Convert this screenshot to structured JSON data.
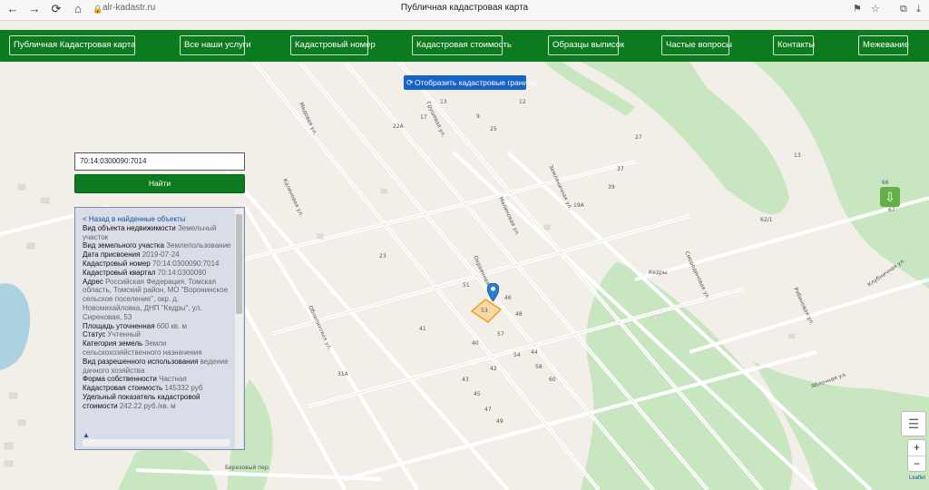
{
  "browser": {
    "url": "alr-kadastr.ru",
    "title": "Публичная кадастровая карта"
  },
  "menu": [
    "Публичная Кадастровая карта",
    "Все наши услуги",
    "Кадастровый номер",
    "Кадастровая стоимость",
    "Образцы выписок",
    "Частые вопросы",
    "Контакты",
    "Межевание"
  ],
  "map": {
    "borders_button": "Отобразить кадастровые границы",
    "search_value": "70:14:0300090:7014",
    "search_button": "Найти",
    "attribution": "Leaflet",
    "place_label": "Кедры",
    "street_labels": [
      "Медовая ул.",
      "Грушевая ул.",
      "Окраинная ул.",
      "Смородиновая ул.",
      "Рябиновая ул.",
      "Яблочная ул.",
      "Клубничная ул.",
      "Березовый пер.",
      "Калиновая ул.",
      "Земляничная ул.",
      "Малиновая ул.",
      "Облепиховая ул."
    ],
    "plot_numbers": [
      "22А",
      "17",
      "13",
      "12",
      "9",
      "51",
      "46",
      "53",
      "57",
      "48",
      "44",
      "40",
      "42",
      "31А",
      "43",
      "45",
      "47",
      "49",
      "54",
      "58",
      "60",
      "62/1",
      "13",
      "19А",
      "25",
      "27",
      "37",
      "39",
      "41",
      "66",
      "67",
      "23"
    ]
  },
  "info": {
    "back": "< Назад в найденные объекты",
    "rows": [
      {
        "label": "Вид объекта недвижимости",
        "value": "Земельный участок"
      },
      {
        "label": "Вид земельного участка",
        "value": "Землепользование"
      },
      {
        "label": "Дата присвоения",
        "value": "2019-07-24"
      },
      {
        "label": "Кадастровый номер",
        "value": "70:14:0300090:7014"
      },
      {
        "label": "Кадастровый квартал",
        "value": "70:14:0300090"
      },
      {
        "label": "Адрес",
        "value": "Российская Федерация, Томская область, Томский район, МО \"Воронинское сельское поселение\", окр. д. Новомихайловка, ДНП \"Кедры\", ул. Сиреновая, 53"
      },
      {
        "label": "Площадь уточненная",
        "value": "600 кв. м"
      },
      {
        "label": "Статус",
        "value": "Учтенный"
      },
      {
        "label": "Категория земель",
        "value": "Земли сельскохозяйственного назначения"
      },
      {
        "label": "Вид разрешенного использования",
        "value": "ведение дачного хозяйства"
      },
      {
        "label": "Форма собственности",
        "value": "Частная"
      },
      {
        "label": "Кадастровая стоимость",
        "value": "145332 руб"
      },
      {
        "label": "Удельный показатель кадастровой стоимости",
        "value": "242.22 руб./кв. м"
      }
    ]
  },
  "colors": {
    "menu_bg": "#0c7a1e",
    "park_green": "#c8e6c0",
    "button_blue": "#1563c7",
    "plot_outline": "#f0a020"
  },
  "icons": [
    "back-icon",
    "forward-icon",
    "reload-icon",
    "lock-icon",
    "refresh-icon",
    "download-arrow-icon",
    "layers-icon",
    "map-marker-icon"
  ]
}
